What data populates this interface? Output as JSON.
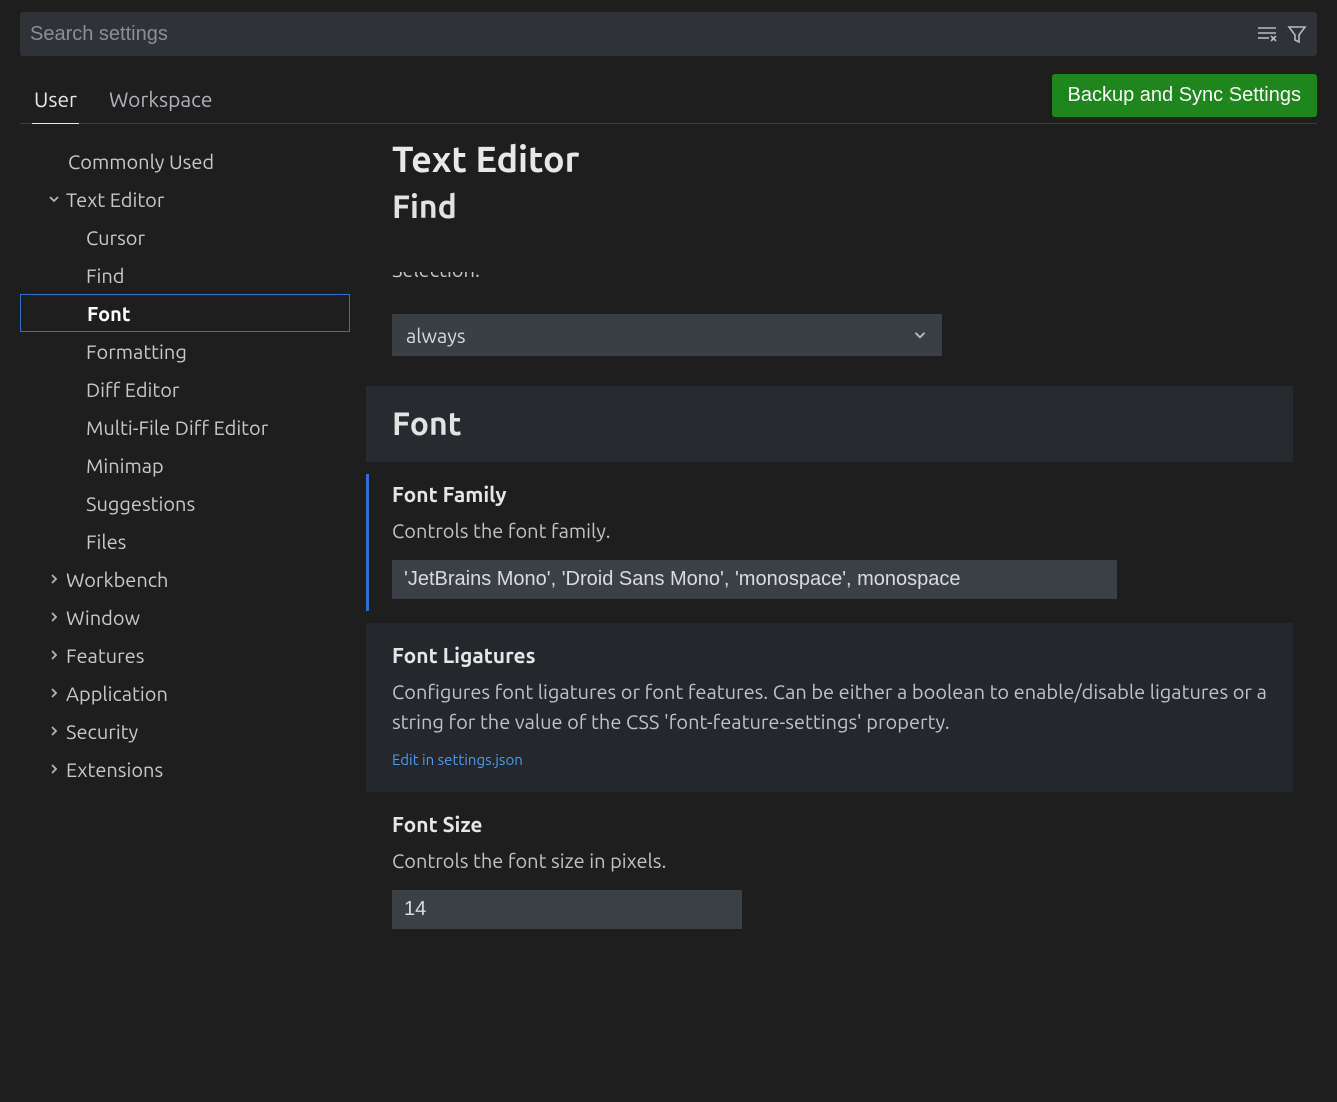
{
  "search": {
    "placeholder": "Search settings"
  },
  "tabs": {
    "user": "User",
    "workspace": "Workspace"
  },
  "sync_button": "Backup and Sync Settings",
  "sidebar": {
    "commonly_used": "Commonly Used",
    "text_editor": "Text Editor",
    "cursor": "Cursor",
    "find": "Find",
    "font": "Font",
    "formatting": "Formatting",
    "diff_editor": "Diff Editor",
    "multi_file_diff": "Multi-File Diff Editor",
    "minimap": "Minimap",
    "suggestions": "Suggestions",
    "files": "Files",
    "workbench": "Workbench",
    "window": "Window",
    "features": "Features",
    "application": "Application",
    "security": "Security",
    "extensions": "Extensions"
  },
  "header": {
    "title": "Text Editor",
    "subtitle": "Find"
  },
  "clipped_label": "Selection.",
  "find_select": {
    "value": "always"
  },
  "font_section": "Font",
  "font_family": {
    "title": "Font Family",
    "desc": "Controls the font family.",
    "value": "'JetBrains Mono', 'Droid Sans Mono', 'monospace', monospace"
  },
  "font_ligatures": {
    "title": "Font Ligatures",
    "desc": "Configures font ligatures or font features. Can be either a boolean to enable/disable ligatures or a string for the value of the CSS 'font-feature-settings' property.",
    "link": "Edit in settings.json"
  },
  "font_size": {
    "title": "Font Size",
    "desc": "Controls the font size in pixels.",
    "value": "14"
  }
}
